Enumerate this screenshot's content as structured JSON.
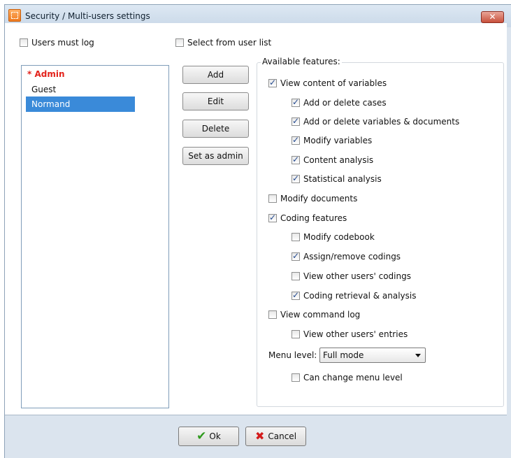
{
  "window": {
    "title": "Security / Multi-users settings",
    "close_glyph": "✕"
  },
  "top_options": {
    "users_must_log": {
      "label": "Users must log",
      "checked": false
    },
    "select_from_user_list": {
      "label": "Select from user list",
      "checked": false
    }
  },
  "users": [
    {
      "label": "* Admin",
      "role": "admin"
    },
    {
      "label": "Guest"
    },
    {
      "label": "Normand",
      "selected": true
    }
  ],
  "buttons": {
    "add": "Add",
    "edit": "Edit",
    "delete": "Delete",
    "set_admin": "Set as admin"
  },
  "features": {
    "label": "Available features:",
    "items": [
      {
        "label": "View content of variables",
        "checked": true,
        "indent": 0
      },
      {
        "label": "Add or delete cases",
        "checked": true,
        "indent": 1
      },
      {
        "label": "Add or delete variables & documents",
        "checked": true,
        "indent": 1
      },
      {
        "label": "Modify variables",
        "checked": true,
        "indent": 1
      },
      {
        "label": "Content analysis",
        "checked": true,
        "indent": 1
      },
      {
        "label": "Statistical analysis",
        "checked": true,
        "indent": 1
      },
      {
        "label": "Modify documents",
        "checked": false,
        "indent": 0
      },
      {
        "label": "Coding features",
        "checked": true,
        "indent": 0
      },
      {
        "label": "Modify codebook",
        "checked": false,
        "indent": 1
      },
      {
        "label": "Assign/remove codings",
        "checked": true,
        "indent": 1
      },
      {
        "label": "View other users' codings",
        "checked": false,
        "indent": 1
      },
      {
        "label": "Coding retrieval & analysis",
        "checked": true,
        "indent": 1
      },
      {
        "label": "View command log",
        "checked": false,
        "indent": 0
      },
      {
        "label": "View other users' entries",
        "checked": false,
        "indent": 1
      }
    ],
    "menu_level_label": "Menu level:",
    "menu_level_value": "Full mode",
    "can_change_menu_level": {
      "label": "Can change menu level",
      "checked": false
    }
  },
  "footer": {
    "ok": "Ok",
    "cancel": "Cancel"
  },
  "icons": {
    "app": "app-icon",
    "ok": "checkmark-icon",
    "cancel": "x-icon"
  },
  "colors": {
    "admin": "#e3231c",
    "selection": "#3a8ad9",
    "check": "#244a8f"
  }
}
